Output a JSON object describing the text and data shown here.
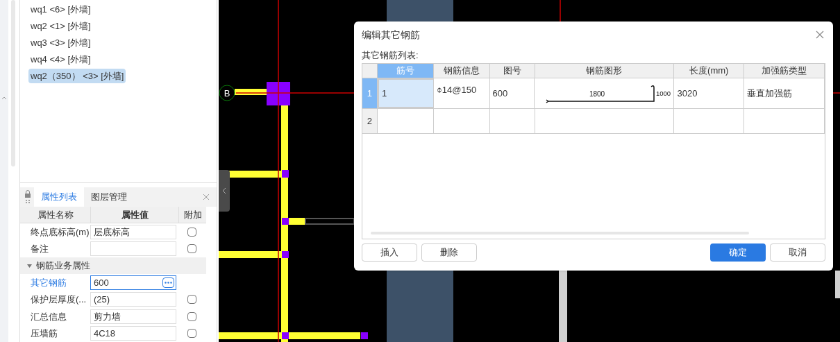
{
  "component_list": [
    {
      "label": "wq1 <6> [外墙]",
      "selected": false
    },
    {
      "label": "wq2 <1> [外墙]",
      "selected": false
    },
    {
      "label": "wq3 <3> [外墙]",
      "selected": false
    },
    {
      "label": "wq4 <4> [外墙]",
      "selected": false
    },
    {
      "label": "wq2（350） <3> [外墙]",
      "selected": true
    }
  ],
  "properties_panel": {
    "tabs": [
      {
        "label": "属性列表",
        "selected": true
      },
      {
        "label": "图层管理",
        "selected": false
      }
    ],
    "columns": [
      "属性名称",
      "属性值",
      "附加"
    ],
    "rows": [
      {
        "kind": "field",
        "name": "终点底标高(m)",
        "value": "层底标高",
        "attached": false
      },
      {
        "kind": "field",
        "name": "备注",
        "value": "",
        "attached": false
      },
      {
        "kind": "group",
        "name": "钢筋业务属性",
        "expanded": true
      },
      {
        "kind": "editor",
        "name": "其它钢筋",
        "value": "600"
      },
      {
        "kind": "field",
        "name": "保护层厚度(...",
        "value": "(25)",
        "attached": false
      },
      {
        "kind": "field",
        "name": "汇总信息",
        "value": "剪力墙",
        "attached": false
      },
      {
        "kind": "field",
        "name": "压墙筋",
        "value": "4C18",
        "attached": false
      }
    ]
  },
  "canvas": {
    "axis_label": "B"
  },
  "dialog": {
    "title": "编辑其它钢筋",
    "list_label": "其它钢筋列表:",
    "columns": [
      {
        "label": "筋号",
        "selected": true
      },
      {
        "label": "钢筋信息",
        "selected": false
      },
      {
        "label": "图号",
        "selected": false
      },
      {
        "label": "钢筋图形",
        "selected": false
      },
      {
        "label": "长度(mm)",
        "selected": false
      },
      {
        "label": "加强筋类型",
        "selected": false
      }
    ],
    "rows": [
      {
        "number": "1",
        "selected": true,
        "bar_no": "1",
        "info": "⌽14@150",
        "shape_no": "600",
        "shape": {
          "horizontal": "1800",
          "vertical": "1000"
        },
        "length": "3020",
        "type": "垂直加强筋"
      },
      {
        "number": "2",
        "selected": false,
        "bar_no": "",
        "info": "",
        "shape_no": "",
        "length": "",
        "type": ""
      }
    ],
    "left_buttons": [
      "插入",
      "删除"
    ],
    "ok": "确定",
    "cancel": "取消"
  }
}
